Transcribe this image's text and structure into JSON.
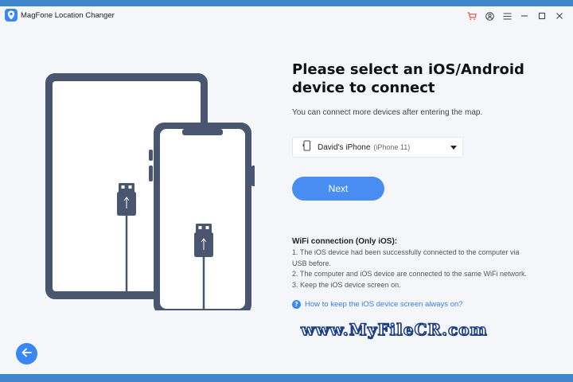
{
  "app": {
    "title": "MagFone Location Changer",
    "accent_color": "#3a86f2",
    "titlebar_icons": [
      "cart-icon",
      "account-icon",
      "menu-icon",
      "minimize-icon",
      "maximize-icon",
      "close-icon"
    ]
  },
  "main": {
    "heading": "Please select an iOS/Android device to connect",
    "subtext": "You can connect more devices after entering the map.",
    "device_select": {
      "name": "David's iPhone",
      "model": "(iPhone 11)"
    },
    "next_label": "Next"
  },
  "wifi": {
    "title": "WiFi connection (Only iOS):",
    "items": [
      "1. The iOS device had been successfully connected to the computer via",
      "USB before.",
      "2. The computer and iOS device are connected to the same WiFi network.",
      "3. Keep the iOS device screen on."
    ],
    "help_link": "How to keep the iOS device screen always on?"
  },
  "watermark": "www.MyFileCR.com"
}
